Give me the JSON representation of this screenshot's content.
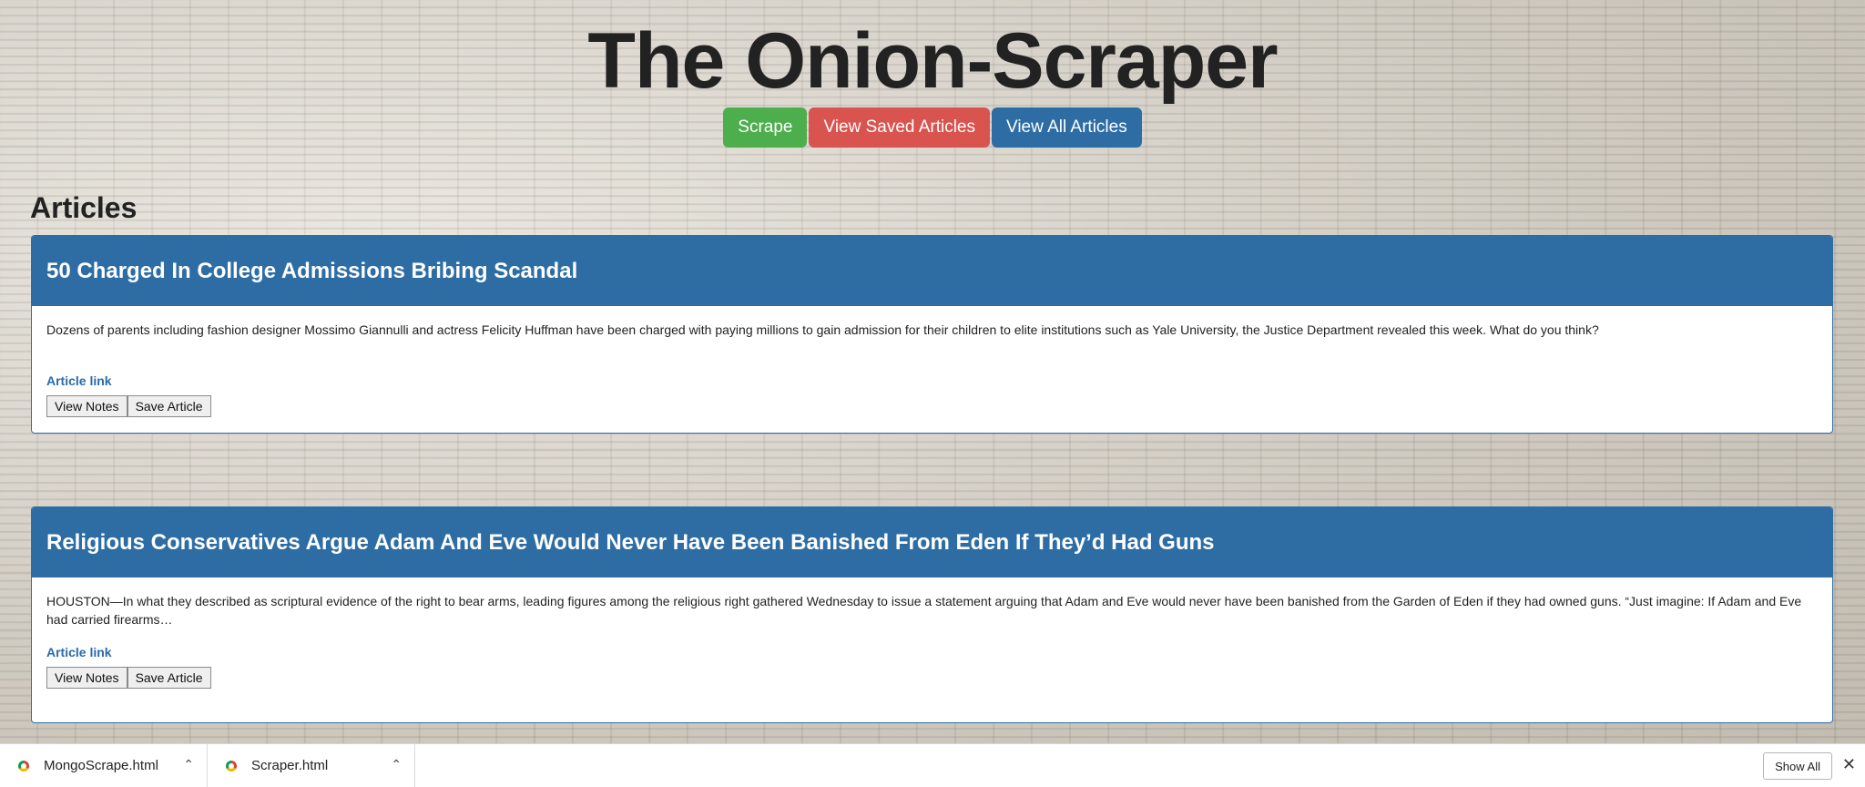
{
  "site": {
    "title": "The Onion-Scraper"
  },
  "nav": {
    "scrape_label": "Scrape",
    "saved_label": "View Saved Articles",
    "all_label": "View All Articles"
  },
  "section": {
    "heading": "Articles"
  },
  "articles": [
    {
      "title": "50 Charged In College Admissions Bribing Scandal",
      "summary": "Dozens of parents including fashion designer Mossimo Giannulli and actress Felicity Huffman have been charged with paying millions to gain admission for their children to elite institutions such as Yale University, the Justice Department revealed this week. What do you think?",
      "link_label": "Article link",
      "notes_label": "View Notes",
      "save_label": "Save Article"
    },
    {
      "title": "Religious Conservatives Argue Adam And Eve Would Never Have Been Banished From Eden If They’d Had Guns",
      "summary": "HOUSTON—In what they described as scriptural evidence of the right to bear arms, leading figures among the religious right gathered Wednesday to issue a statement arguing that Adam and Eve would never have been banished from the Garden of Eden if they had owned guns. “Just imagine: If Adam and Eve had carried firearms…",
      "link_label": "Article link",
      "notes_label": "View Notes",
      "save_label": "Save Article"
    }
  ],
  "downloads": {
    "items": [
      {
        "filename": "MongoScrape.html",
        "icon": "chrome-file-icon"
      },
      {
        "filename": "Scraper.html",
        "icon": "chrome-file-icon"
      }
    ],
    "show_all_label": "Show All"
  },
  "colors": {
    "primary": "#2e6da4",
    "success": "#4cae4c",
    "danger": "#d9534f"
  }
}
